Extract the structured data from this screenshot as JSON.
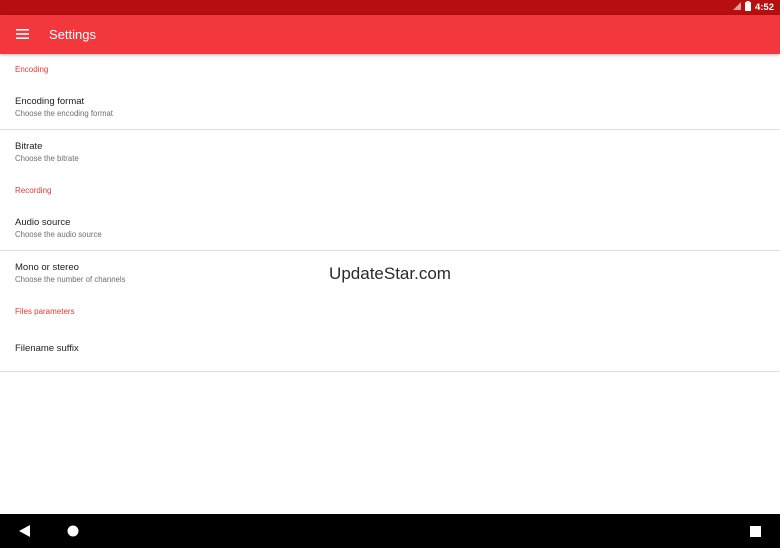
{
  "status_bar": {
    "time": "4:52",
    "icons": [
      "signal-icon",
      "battery-icon"
    ]
  },
  "toolbar": {
    "title": "Settings",
    "menu_icon": "hamburger-menu-icon"
  },
  "sections": [
    {
      "header": "Encoding",
      "items": [
        {
          "title": "Encoding format",
          "summary": "Choose the encoding format"
        },
        {
          "title": "Bitrate",
          "summary": "Choose the bitrate"
        }
      ]
    },
    {
      "header": "Recording",
      "items": [
        {
          "title": "Audio source",
          "summary": "Choose the audio source"
        },
        {
          "title": "Mono or stereo",
          "summary": "Choose the number of channels"
        }
      ]
    },
    {
      "header": "Files parameters",
      "items": [
        {
          "title": "Filename suffix",
          "summary": ""
        }
      ]
    }
  ],
  "watermark": "UpdateStar.com",
  "nav_bar": {
    "buttons": [
      "back-icon",
      "home-icon",
      "recents-icon"
    ]
  },
  "colors": {
    "status_bar": "#b70f0f",
    "toolbar": "#f3383d",
    "section_header": "#e53935"
  }
}
